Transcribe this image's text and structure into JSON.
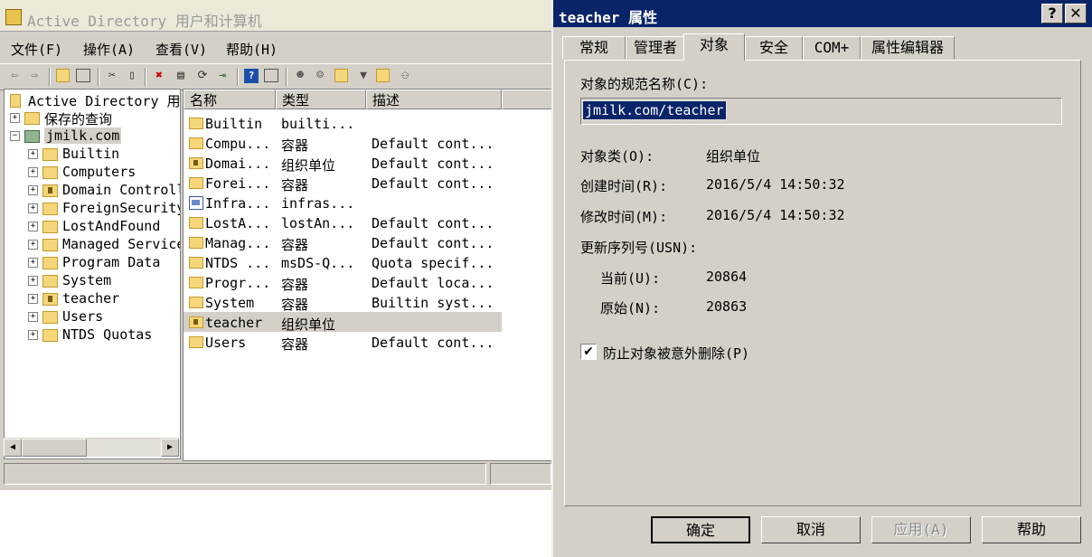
{
  "aduc": {
    "title": "Active Directory 用户和计算机",
    "menu": [
      "文件(F)",
      "操作(A)",
      "查看(V)",
      "帮助(H)"
    ],
    "tree": {
      "root": "Active Directory 用",
      "saved_queries": "保存的查询",
      "domain": "jmilk.com",
      "children": [
        "Builtin",
        "Computers",
        "Domain Controll",
        "ForeignSecurity",
        "LostAndFound",
        "Managed Service",
        "Program Data",
        "System",
        "teacher",
        "Users",
        "NTDS Quotas"
      ]
    },
    "list": {
      "columns": [
        "名称",
        "类型",
        "描述"
      ],
      "rows": [
        {
          "name": "Builtin",
          "type": "builti...",
          "desc": "",
          "icon": "folder-icon"
        },
        {
          "name": "Compu...",
          "type": "容器",
          "desc": "Default cont...",
          "icon": "folder-icon"
        },
        {
          "name": "Domai...",
          "type": "组织单位",
          "desc": "Default cont...",
          "icon": "ou-icon"
        },
        {
          "name": "Forei...",
          "type": "容器",
          "desc": "Default cont...",
          "icon": "folder-icon"
        },
        {
          "name": "Infra...",
          "type": "infras...",
          "desc": "",
          "icon": "infrastructure-icon"
        },
        {
          "name": "LostA...",
          "type": "lostAn...",
          "desc": "Default cont...",
          "icon": "folder-icon"
        },
        {
          "name": "Manag...",
          "type": "容器",
          "desc": "Default cont...",
          "icon": "folder-icon"
        },
        {
          "name": "NTDS ...",
          "type": "msDS-Q...",
          "desc": "Quota specif...",
          "icon": "folder-icon"
        },
        {
          "name": "Progr...",
          "type": "容器",
          "desc": "Default loca...",
          "icon": "folder-icon"
        },
        {
          "name": "System",
          "type": "容器",
          "desc": "Builtin syst...",
          "icon": "folder-icon"
        },
        {
          "name": "teacher",
          "type": "组织单位",
          "desc": "",
          "icon": "ou-icon",
          "selected": true
        },
        {
          "name": "Users",
          "type": "容器",
          "desc": "Default cont...",
          "icon": "folder-icon"
        }
      ]
    }
  },
  "dialog": {
    "title": "teacher 属性",
    "help_btn": "?",
    "close_btn": "✕",
    "tabs": [
      "常规",
      "管理者",
      "对象",
      "安全",
      "COM+",
      "属性编辑器"
    ],
    "active_tab": "对象",
    "dn_label": "对象的规范名称(C):",
    "dn_value": "jmilk.com/teacher",
    "object_class_label": "对象类(O):",
    "object_class_value": "组织单位",
    "created_label": "创建时间(R):",
    "created_value": "2016/5/4 14:50:32",
    "modified_label": "修改时间(M):",
    "modified_value": "2016/5/4 14:50:32",
    "usn_label": "更新序列号(USN):",
    "usn_current_label": "当前(U):",
    "usn_current_value": "20864",
    "usn_original_label": "原始(N):",
    "usn_original_value": "20863",
    "protect_label": "防止对象被意外删除(P)",
    "protect_checked": true,
    "buttons": {
      "ok": "确定",
      "cancel": "取消",
      "apply": "应用(A)",
      "help": "帮助"
    }
  },
  "colors": {
    "dialog_title_bg": "#0a246a",
    "selection_bg": "#0a246a",
    "face": "#d4d0c8"
  }
}
